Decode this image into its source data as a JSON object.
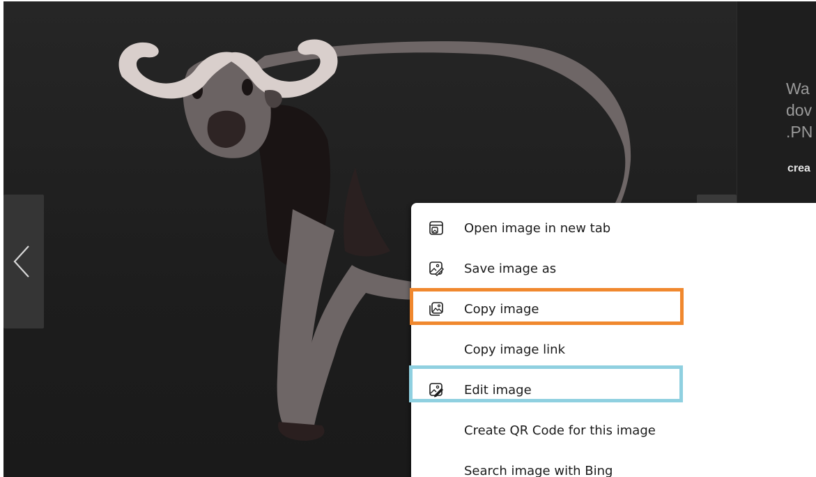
{
  "viewer": {
    "side_text_lines": [
      "Wa",
      "dov",
      ".PN"
    ],
    "side_link": "crea",
    "prev_icon": "chevron-left-icon"
  },
  "context_menu": {
    "items": [
      {
        "label": "Open image in new tab",
        "icon": "open-in-new-tab-icon"
      },
      {
        "label": "Save image as",
        "icon": "save-image-icon"
      },
      {
        "label": "Copy image",
        "icon": "copy-image-icon"
      },
      {
        "label": "Copy image link",
        "icon": ""
      },
      {
        "label": "Edit image",
        "icon": "edit-image-icon"
      },
      {
        "label": "Create QR Code for this image",
        "icon": ""
      },
      {
        "label": "Search image with Bing",
        "icon": ""
      }
    ]
  },
  "highlights": {
    "orange": "#f0882e",
    "blue": "#8fd0e0"
  }
}
